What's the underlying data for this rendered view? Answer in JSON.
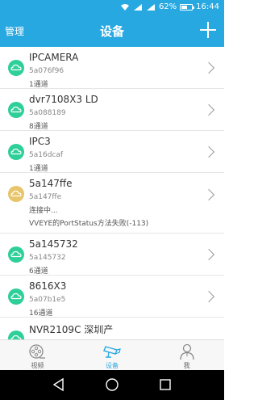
{
  "status_bar": {
    "battery": "62%",
    "time": "16:44",
    "battery_level": 0.62
  },
  "header": {
    "left_label": "管理",
    "title": "设备",
    "add_icon": "plus-icon"
  },
  "devices": [
    {
      "name": "IPCAMERA",
      "id": "5a076f96",
      "channels": "1通道",
      "status": "online"
    },
    {
      "name": "dvr7108X3 LD",
      "id": "5a088189",
      "channels": "8通道",
      "status": "online"
    },
    {
      "name": "IPC3",
      "id": "5a16dcaf",
      "channels": "1通道",
      "status": "online"
    },
    {
      "name": "5a147ffe",
      "id": "5a147ffe",
      "channels": "连接中...",
      "status": "connecting",
      "error": "VVEYE的PortStatus方法失败(-113)"
    },
    {
      "name": "5a145732",
      "id": "5a145732",
      "channels": "6通道",
      "status": "online"
    },
    {
      "name": "8616X3",
      "id": "5a07b1e5",
      "channels": "16通道",
      "status": "online"
    },
    {
      "name": "NVR2109C 深圳产",
      "id": "",
      "channels": "",
      "status": "online"
    }
  ],
  "tabs": [
    {
      "label": "视频",
      "icon": "film-reel-icon"
    },
    {
      "label": "设备",
      "icon": "camera-icon"
    },
    {
      "label": "我",
      "icon": "person-icon"
    }
  ],
  "colors": {
    "accent": "#28a8e0",
    "online": "#2fcf9a",
    "connecting": "#e8c46a"
  }
}
